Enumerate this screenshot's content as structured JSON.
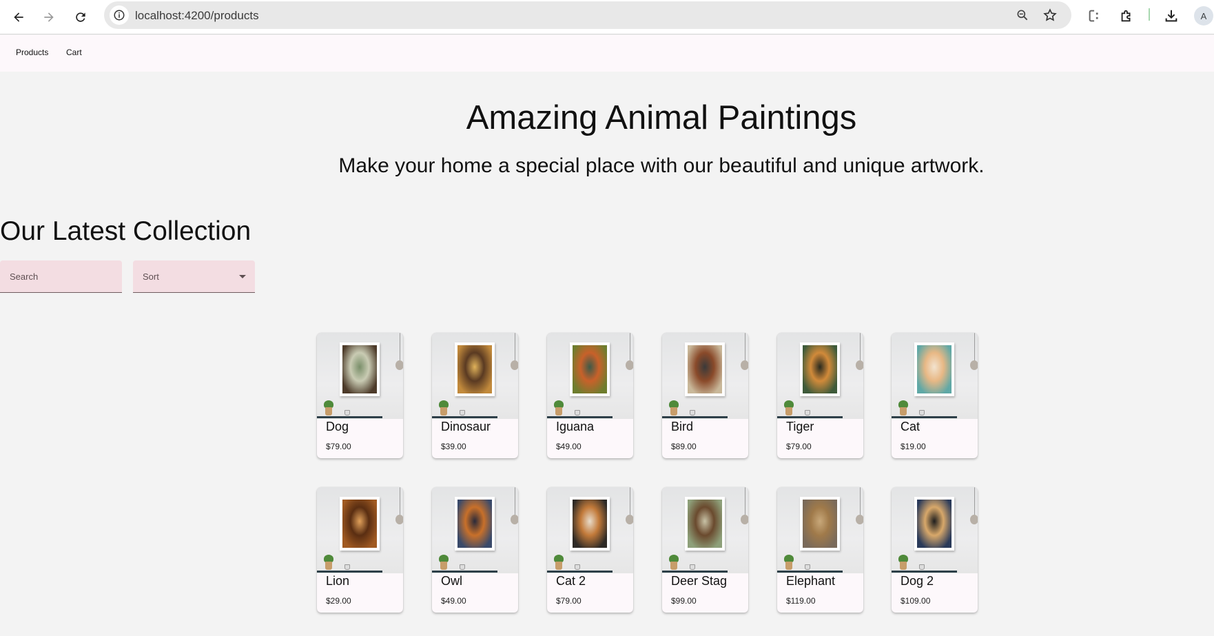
{
  "browser": {
    "url": "localhost:4200/products",
    "avatar_letter": "A",
    "icons": [
      "back-arrow-icon",
      "forward-arrow-icon",
      "reload-icon",
      "site-info-icon",
      "zoom-icon",
      "bookmark-star-icon",
      "extension-icon",
      "extensions-puzzle-icon",
      "download-icon"
    ]
  },
  "app_nav": {
    "products": "Products",
    "cart": "Cart"
  },
  "hero": {
    "title": "Amazing Animal Paintings",
    "subtitle": "Make your home a special place with our beautiful and unique artwork."
  },
  "collection": {
    "title": "Our Latest Collection",
    "search_placeholder": "Search",
    "sort_label": "Sort"
  },
  "products": [
    {
      "name": "Dog",
      "price": "$79.00",
      "art": [
        "#4d3b2a",
        "#c9cbb3",
        "#7a8f6a"
      ]
    },
    {
      "name": "Dinosaur",
      "price": "$39.00",
      "art": [
        "#c28a3c",
        "#5a3a22",
        "#e0b25a"
      ]
    },
    {
      "name": "Iguana",
      "price": "$49.00",
      "art": [
        "#6e7d2e",
        "#c8612a",
        "#3e5a48"
      ]
    },
    {
      "name": "Bird",
      "price": "$89.00",
      "art": [
        "#c9b89a",
        "#8a4a2a",
        "#3a3a3a"
      ]
    },
    {
      "name": "Tiger",
      "price": "$79.00",
      "art": [
        "#3e5a3a",
        "#d18a3a",
        "#2a2a1e"
      ]
    },
    {
      "name": "Cat",
      "price": "$19.00",
      "art": [
        "#5fa8a6",
        "#e8b885",
        "#f2e3cf"
      ]
    },
    {
      "name": "Lion",
      "price": "$29.00",
      "art": [
        "#a05a22",
        "#5a2e12",
        "#e0a05a"
      ]
    },
    {
      "name": "Owl",
      "price": "$49.00",
      "art": [
        "#3a4a6a",
        "#c8702a",
        "#2a2a3a"
      ]
    },
    {
      "name": "Cat 2",
      "price": "$79.00",
      "art": [
        "#2e2a26",
        "#c27a3a",
        "#e8dccb"
      ]
    },
    {
      "name": "Deer Stag",
      "price": "$99.00",
      "art": [
        "#8ea07a",
        "#6a4a2e",
        "#c8c2a6"
      ]
    },
    {
      "name": "Elephant",
      "price": "$119.00",
      "art": [
        "#7a6a5a",
        "#a07a4a",
        "#c8a87a"
      ]
    },
    {
      "name": "Dog 2",
      "price": "$109.00",
      "art": [
        "#2a3a5a",
        "#d8a86a",
        "#1e1e1e"
      ]
    }
  ]
}
